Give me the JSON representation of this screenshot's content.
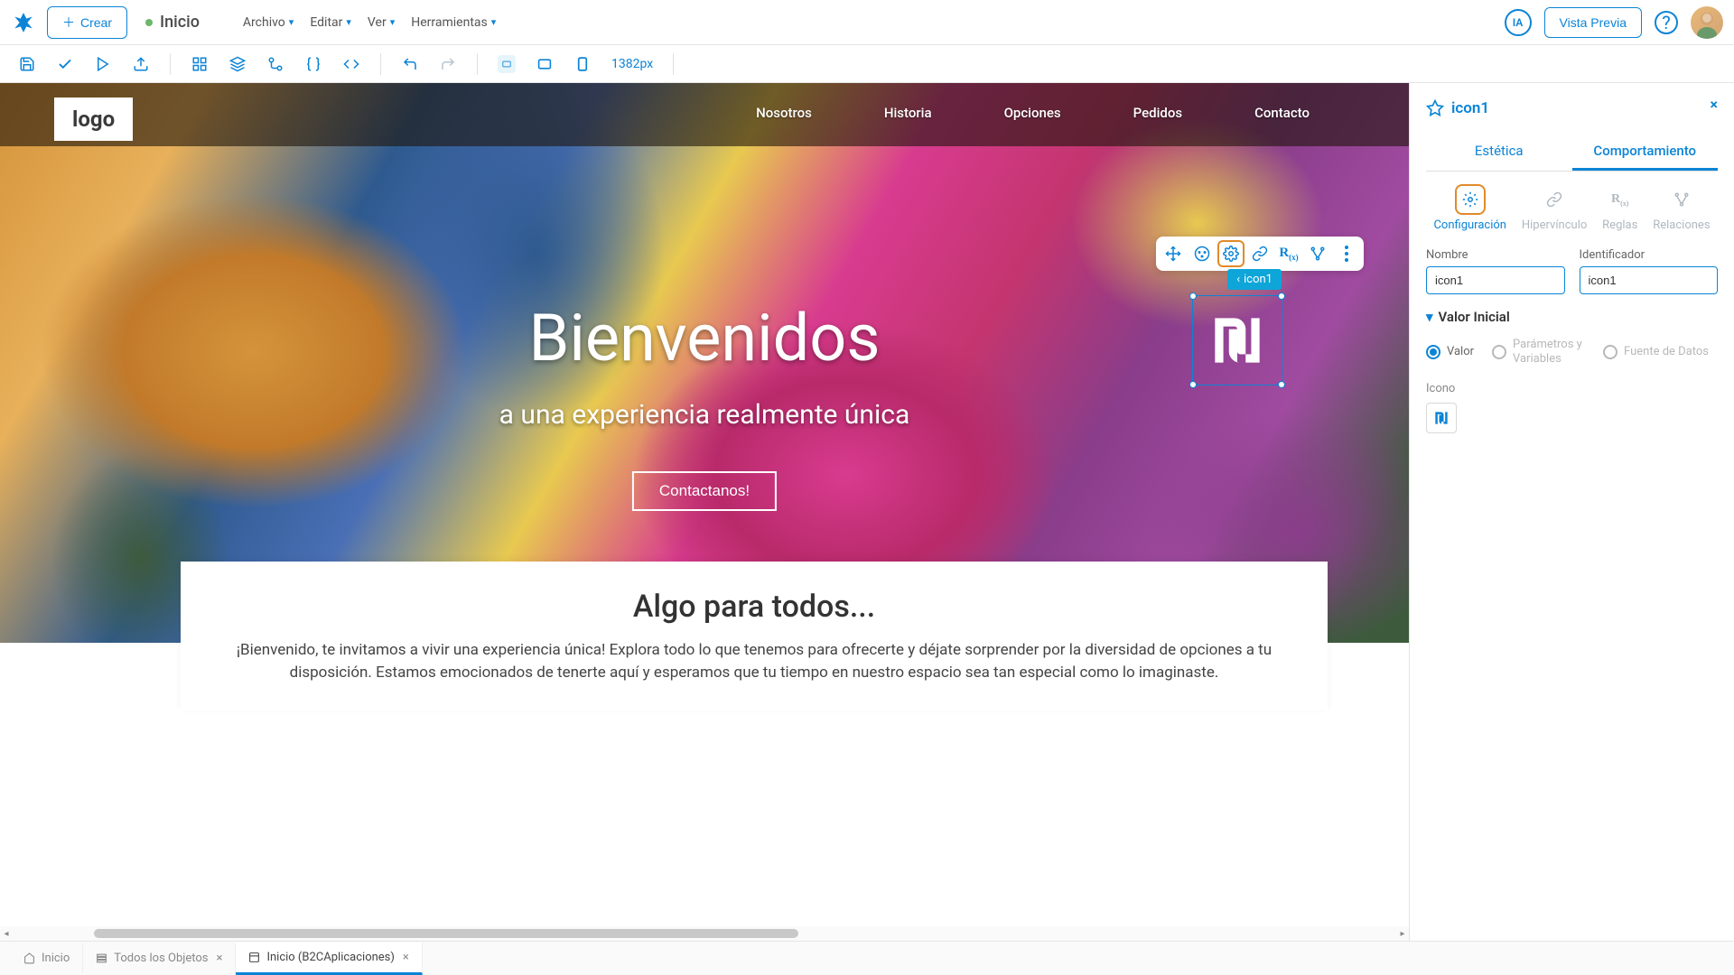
{
  "topbar": {
    "create_label": "Crear",
    "home_label": "Inicio",
    "menus": [
      "Archivo",
      "Editar",
      "Ver",
      "Herramientas"
    ],
    "ia_label": "IA",
    "preview_label": "Vista Previa"
  },
  "toolbar": {
    "viewport_px": "1382px"
  },
  "canvas": {
    "logo_text": "logo",
    "nav_items": [
      "Nosotros",
      "Historia",
      "Opciones",
      "Pedidos",
      "Contacto"
    ],
    "hero_title": "Bienvenidos",
    "hero_subtitle": "a una experiencia realmente única",
    "hero_button": "Contactanos!",
    "selection_label": "icon1",
    "card_heading": "Algo para todos...",
    "card_body": "¡Bienvenido, te invitamos a vivir una experiencia única! Explora todo lo que tenemos para ofrecerte y déjate sorprender por la diversidad de opciones a tu disposición. Estamos emocionados de tenerte aquí y esperamos que tu tiempo en nuestro espacio sea tan especial como lo imaginaste."
  },
  "sidebar": {
    "title": "icon1",
    "tabs": {
      "aesthetics": "Estética",
      "behavior": "Comportamiento"
    },
    "subtabs": {
      "config": "Configuración",
      "link": "Hipervínculo",
      "rules": "Reglas",
      "relations": "Relaciones"
    },
    "fields": {
      "name_label": "Nombre",
      "name_value": "icon1",
      "id_label": "Identificador",
      "id_value": "icon1"
    },
    "initial_value_heading": "Valor Inicial",
    "radios": {
      "value": "Valor",
      "params": "Parámetros y Variables",
      "datasource": "Fuente de Datos"
    },
    "icono_label": "Icono"
  },
  "bottombar": {
    "tabs": [
      {
        "icon": "home",
        "label": "Inicio",
        "closable": false,
        "active": false
      },
      {
        "icon": "objects",
        "label": "Todos los Objetos",
        "closable": true,
        "active": false
      },
      {
        "icon": "page",
        "label": "Inicio (B2CAplicaciones)",
        "closable": true,
        "active": true
      }
    ]
  }
}
